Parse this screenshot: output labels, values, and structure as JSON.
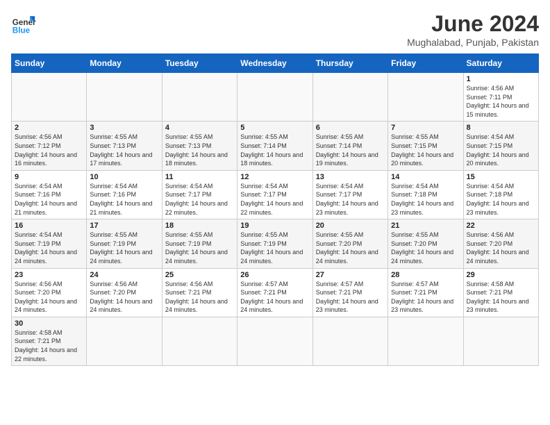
{
  "header": {
    "logo_general": "General",
    "logo_blue": "Blue",
    "month": "June 2024",
    "location": "Mughalabad, Punjab, Pakistan"
  },
  "weekdays": [
    "Sunday",
    "Monday",
    "Tuesday",
    "Wednesday",
    "Thursday",
    "Friday",
    "Saturday"
  ],
  "weeks": [
    [
      {
        "day": "",
        "info": ""
      },
      {
        "day": "",
        "info": ""
      },
      {
        "day": "",
        "info": ""
      },
      {
        "day": "",
        "info": ""
      },
      {
        "day": "",
        "info": ""
      },
      {
        "day": "",
        "info": ""
      },
      {
        "day": "1",
        "info": "Sunrise: 4:56 AM\nSunset: 7:11 PM\nDaylight: 14 hours\nand 15 minutes."
      }
    ],
    [
      {
        "day": "2",
        "info": "Sunrise: 4:56 AM\nSunset: 7:12 PM\nDaylight: 14 hours\nand 16 minutes."
      },
      {
        "day": "3",
        "info": "Sunrise: 4:55 AM\nSunset: 7:13 PM\nDaylight: 14 hours\nand 17 minutes."
      },
      {
        "day": "4",
        "info": "Sunrise: 4:55 AM\nSunset: 7:13 PM\nDaylight: 14 hours\nand 18 minutes."
      },
      {
        "day": "5",
        "info": "Sunrise: 4:55 AM\nSunset: 7:14 PM\nDaylight: 14 hours\nand 18 minutes."
      },
      {
        "day": "6",
        "info": "Sunrise: 4:55 AM\nSunset: 7:14 PM\nDaylight: 14 hours\nand 19 minutes."
      },
      {
        "day": "7",
        "info": "Sunrise: 4:55 AM\nSunset: 7:15 PM\nDaylight: 14 hours\nand 20 minutes."
      },
      {
        "day": "8",
        "info": "Sunrise: 4:54 AM\nSunset: 7:15 PM\nDaylight: 14 hours\nand 20 minutes."
      }
    ],
    [
      {
        "day": "9",
        "info": "Sunrise: 4:54 AM\nSunset: 7:16 PM\nDaylight: 14 hours\nand 21 minutes."
      },
      {
        "day": "10",
        "info": "Sunrise: 4:54 AM\nSunset: 7:16 PM\nDaylight: 14 hours\nand 21 minutes."
      },
      {
        "day": "11",
        "info": "Sunrise: 4:54 AM\nSunset: 7:17 PM\nDaylight: 14 hours\nand 22 minutes."
      },
      {
        "day": "12",
        "info": "Sunrise: 4:54 AM\nSunset: 7:17 PM\nDaylight: 14 hours\nand 22 minutes."
      },
      {
        "day": "13",
        "info": "Sunrise: 4:54 AM\nSunset: 7:17 PM\nDaylight: 14 hours\nand 23 minutes."
      },
      {
        "day": "14",
        "info": "Sunrise: 4:54 AM\nSunset: 7:18 PM\nDaylight: 14 hours\nand 23 minutes."
      },
      {
        "day": "15",
        "info": "Sunrise: 4:54 AM\nSunset: 7:18 PM\nDaylight: 14 hours\nand 23 minutes."
      }
    ],
    [
      {
        "day": "16",
        "info": "Sunrise: 4:54 AM\nSunset: 7:19 PM\nDaylight: 14 hours\nand 24 minutes."
      },
      {
        "day": "17",
        "info": "Sunrise: 4:55 AM\nSunset: 7:19 PM\nDaylight: 14 hours\nand 24 minutes."
      },
      {
        "day": "18",
        "info": "Sunrise: 4:55 AM\nSunset: 7:19 PM\nDaylight: 14 hours\nand 24 minutes."
      },
      {
        "day": "19",
        "info": "Sunrise: 4:55 AM\nSunset: 7:19 PM\nDaylight: 14 hours\nand 24 minutes."
      },
      {
        "day": "20",
        "info": "Sunrise: 4:55 AM\nSunset: 7:20 PM\nDaylight: 14 hours\nand 24 minutes."
      },
      {
        "day": "21",
        "info": "Sunrise: 4:55 AM\nSunset: 7:20 PM\nDaylight: 14 hours\nand 24 minutes."
      },
      {
        "day": "22",
        "info": "Sunrise: 4:56 AM\nSunset: 7:20 PM\nDaylight: 14 hours\nand 24 minutes."
      }
    ],
    [
      {
        "day": "23",
        "info": "Sunrise: 4:56 AM\nSunset: 7:20 PM\nDaylight: 14 hours\nand 24 minutes."
      },
      {
        "day": "24",
        "info": "Sunrise: 4:56 AM\nSunset: 7:20 PM\nDaylight: 14 hours\nand 24 minutes."
      },
      {
        "day": "25",
        "info": "Sunrise: 4:56 AM\nSunset: 7:21 PM\nDaylight: 14 hours\nand 24 minutes."
      },
      {
        "day": "26",
        "info": "Sunrise: 4:57 AM\nSunset: 7:21 PM\nDaylight: 14 hours\nand 24 minutes."
      },
      {
        "day": "27",
        "info": "Sunrise: 4:57 AM\nSunset: 7:21 PM\nDaylight: 14 hours\nand 23 minutes."
      },
      {
        "day": "28",
        "info": "Sunrise: 4:57 AM\nSunset: 7:21 PM\nDaylight: 14 hours\nand 23 minutes."
      },
      {
        "day": "29",
        "info": "Sunrise: 4:58 AM\nSunset: 7:21 PM\nDaylight: 14 hours\nand 23 minutes."
      }
    ],
    [
      {
        "day": "30",
        "info": "Sunrise: 4:58 AM\nSunset: 7:21 PM\nDaylight: 14 hours\nand 22 minutes."
      },
      {
        "day": "",
        "info": ""
      },
      {
        "day": "",
        "info": ""
      },
      {
        "day": "",
        "info": ""
      },
      {
        "day": "",
        "info": ""
      },
      {
        "day": "",
        "info": ""
      },
      {
        "day": "",
        "info": ""
      }
    ]
  ]
}
